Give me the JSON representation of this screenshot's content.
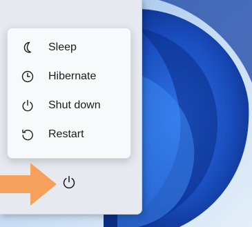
{
  "power_menu": {
    "items": [
      {
        "label": "Sleep",
        "icon": "moon-icon"
      },
      {
        "label": "Hibernate",
        "icon": "clock-icon"
      },
      {
        "label": "Shut down",
        "icon": "power-icon"
      },
      {
        "label": "Restart",
        "icon": "restart-icon"
      }
    ]
  },
  "start_panel": {
    "power_button_icon": "power-icon"
  },
  "annotation": {
    "arrow_color": "#f5a15b"
  },
  "colors": {
    "menu_background": "#f7f9fb",
    "panel_background": "#e6eaf0",
    "text": "#1b1b1b",
    "wallpaper_accent": "#1a55c8"
  }
}
